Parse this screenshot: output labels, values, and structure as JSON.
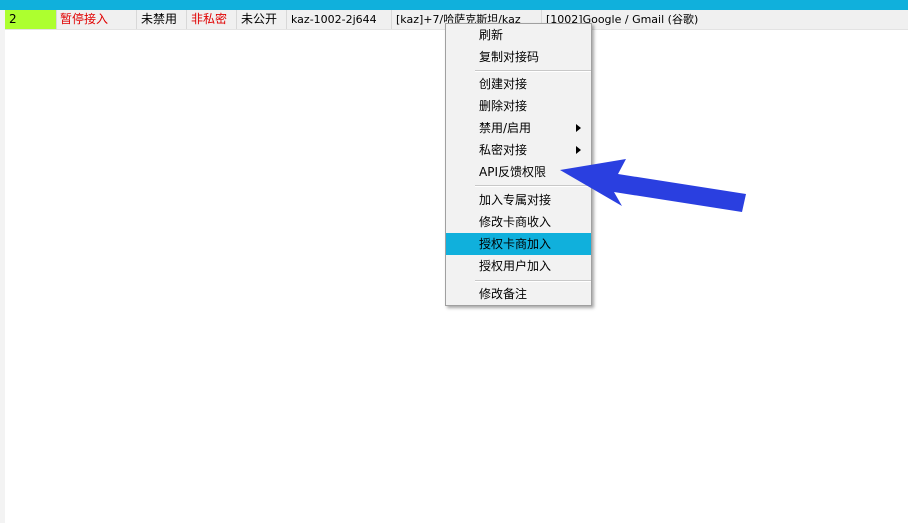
{
  "row": {
    "index": "2",
    "status": "暂停接入",
    "disabled": "未禁用",
    "private": "非私密",
    "public": "未公开",
    "code": "kaz-1002-2j644",
    "region": "[kaz]+7/哈萨克斯坦/kaz",
    "service": "[1002]Google / Gmail (谷歌)"
  },
  "menu": {
    "refresh": "刷新",
    "copy_code": "复制对接码",
    "create": "创建对接",
    "delete": "删除对接",
    "toggle": "禁用/启用",
    "private": "私密对接",
    "api_feedback": "API反馈权限",
    "add_exclusive": "加入专属对接",
    "edit_income": "修改卡商收入",
    "authorize_vendor": "授权卡商加入",
    "authorize_user": "授权用户加入",
    "edit_note": "修改备注"
  },
  "colors": {
    "accent": "#10b0dc",
    "index_cell": "#adff2f",
    "warning_text": "#e00000",
    "annotation_arrow": "#2a3fe0"
  }
}
